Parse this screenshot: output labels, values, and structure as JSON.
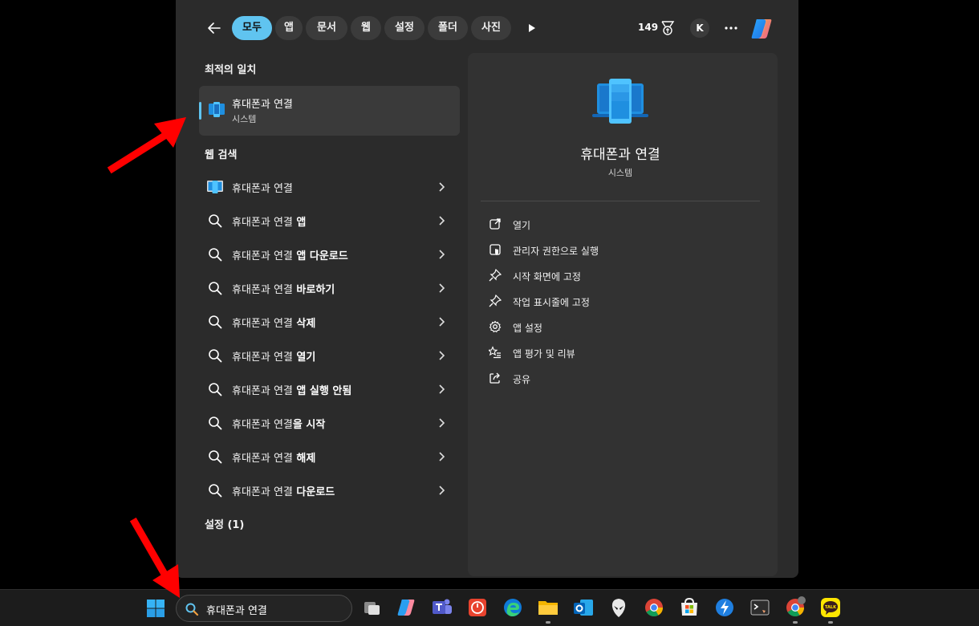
{
  "filter_bar": {
    "chips": [
      {
        "label": "모두",
        "active": true
      },
      {
        "label": "앱",
        "active": false
      },
      {
        "label": "문서",
        "active": false
      },
      {
        "label": "웹",
        "active": false
      },
      {
        "label": "설정",
        "active": false
      },
      {
        "label": "폴더",
        "active": false
      },
      {
        "label": "사진",
        "active": false
      }
    ],
    "points": "149",
    "avatar_letter": "K"
  },
  "best_match": {
    "section_title": "최적의 일치",
    "name": "휴대폰과 연결",
    "type": "시스템",
    "icon": "phone-link-icon"
  },
  "web_search": {
    "section_title": "웹 검색",
    "items": [
      {
        "query": "휴대폰과 연결",
        "suffix": "",
        "icon": "phone-link-icon"
      },
      {
        "query": "휴대폰과 연결",
        "suffix": " 앱",
        "icon": "search-icon"
      },
      {
        "query": "휴대폰과 연결",
        "suffix": " 앱 다운로드",
        "icon": "search-icon"
      },
      {
        "query": "휴대폰과 연결",
        "suffix": " 바로하기",
        "icon": "search-icon"
      },
      {
        "query": "휴대폰과 연결",
        "suffix": " 삭제",
        "icon": "search-icon"
      },
      {
        "query": "휴대폰과 연결",
        "suffix": " 열기",
        "icon": "search-icon"
      },
      {
        "query": "휴대폰과 연결",
        "suffix": " 앱 실행 안됨",
        "icon": "search-icon"
      },
      {
        "query": "휴대폰과 연결",
        "suffix": "을 시작",
        "icon": "search-icon"
      },
      {
        "query": "휴대폰과 연결",
        "suffix": " 해제",
        "icon": "search-icon"
      },
      {
        "query": "휴대폰과 연결",
        "suffix": " 다운로드",
        "icon": "search-icon"
      }
    ]
  },
  "settings_section": {
    "title": "설정 (1)"
  },
  "details": {
    "name": "휴대폰과 연결",
    "type": "시스템",
    "actions": [
      {
        "label": "열기",
        "icon": "open-external-icon"
      },
      {
        "label": "관리자 권한으로 실행",
        "icon": "shield-run-icon"
      },
      {
        "label": "시작 화면에 고정",
        "icon": "pin-icon"
      },
      {
        "label": "작업 표시줄에 고정",
        "icon": "pin-icon"
      },
      {
        "label": "앱 설정",
        "icon": "gear-icon"
      },
      {
        "label": "앱 평가 및 리뷰",
        "icon": "star-list-icon"
      },
      {
        "label": "공유",
        "icon": "share-icon"
      }
    ]
  },
  "taskbar": {
    "search_text": "휴대폰과 연결",
    "apps": [
      "task-view-icon",
      "copilot-icon",
      "teams-icon",
      "power-app-icon",
      "edge-icon",
      "file-explorer-icon",
      "outlook-icon",
      "alienware-icon",
      "chrome-icon",
      "microsoft-store-icon",
      "bolt-app-icon",
      "terminal-icon",
      "chrome-profile-icon",
      "kakaotalk-icon"
    ],
    "kakaotalk_label": "TALK"
  },
  "colors": {
    "accent": "#60c4f0",
    "panel_bg": "#2b2b2b",
    "details_bg": "#323232",
    "arrow_red": "#ff0000"
  }
}
